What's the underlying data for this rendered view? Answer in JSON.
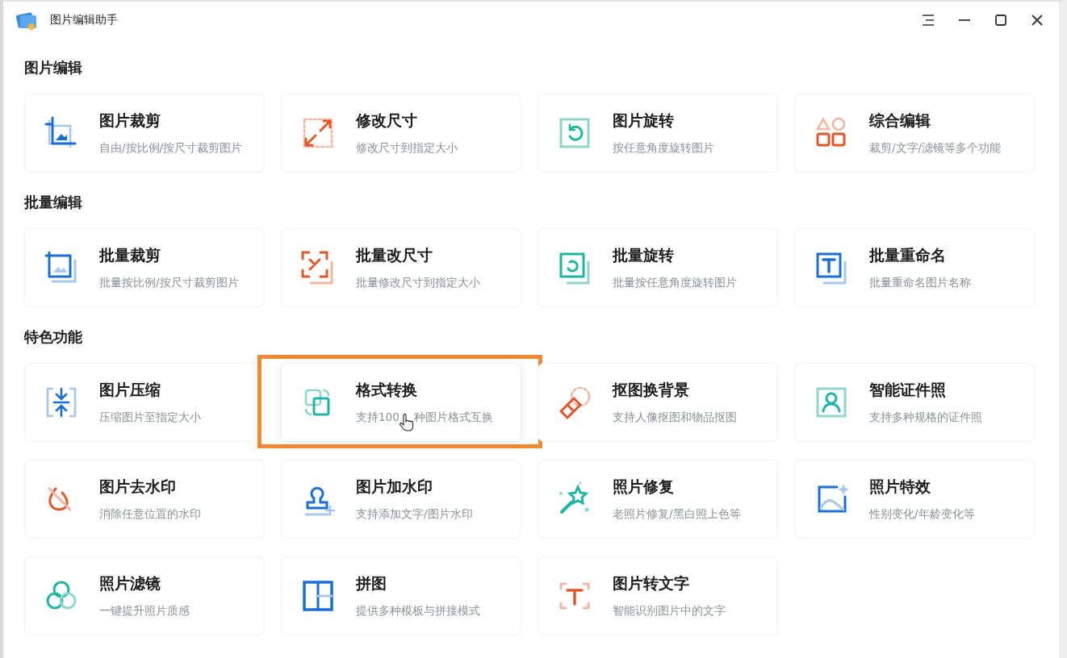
{
  "window": {
    "title": "图片编辑助手"
  },
  "sections": [
    {
      "title": "图片编辑",
      "cards": [
        {
          "title": "图片裁剪",
          "description": "自由/按比例/按尺寸裁剪图片",
          "hovered": false,
          "highlighted": false
        },
        {
          "title": "修改尺寸",
          "description": "修改尺寸到指定大小",
          "hovered": false,
          "highlighted": false
        },
        {
          "title": "图片旋转",
          "description": "按任意角度旋转图片",
          "hovered": false,
          "highlighted": false
        },
        {
          "title": "综合编辑",
          "description": "裁剪/文字/滤镜等多个功能",
          "hovered": false,
          "highlighted": false
        }
      ]
    },
    {
      "title": "批量编辑",
      "cards": [
        {
          "title": "批量裁剪",
          "description": "批量按比例/按尺寸裁剪图片",
          "hovered": false,
          "highlighted": false
        },
        {
          "title": "批量改尺寸",
          "description": "批量修改尺寸到指定大小",
          "hovered": false,
          "highlighted": false
        },
        {
          "title": "批量旋转",
          "description": "批量按任意角度旋转图片",
          "hovered": false,
          "highlighted": false
        },
        {
          "title": "批量重命名",
          "description": "批量重命名图片名称",
          "hovered": false,
          "highlighted": false
        }
      ]
    },
    {
      "title": "特色功能",
      "cards": [
        {
          "title": "图片压缩",
          "description": "压缩图片至指定大小",
          "hovered": false,
          "highlighted": false
        },
        {
          "title": "格式转换",
          "description": "支持100",
          "description_after_cursor": "种图片格式互换",
          "hovered": true,
          "highlighted": true
        },
        {
          "title": "抠图换背景",
          "description": "支持人像抠图和物品抠图",
          "hovered": false,
          "highlighted": false
        },
        {
          "title": "智能证件照",
          "description": "支持多种规格的证件照",
          "hovered": false,
          "highlighted": false
        },
        {
          "title": "图片去水印",
          "description": "消除任意位置的水印",
          "hovered": false,
          "highlighted": false
        },
        {
          "title": "图片加水印",
          "description": "支持添加文字/图片水印",
          "hovered": false,
          "highlighted": false
        },
        {
          "title": "照片修复",
          "description": "老照片修复/黑白照上色等",
          "hovered": false,
          "highlighted": false
        },
        {
          "title": "照片特效",
          "description": "性别变化/年龄变化等",
          "hovered": false,
          "highlighted": false
        },
        {
          "title": "照片滤镜",
          "description": "一键提升照片质感",
          "hovered": false,
          "highlighted": false
        },
        {
          "title": "拼图",
          "description": "提供多种模板与拼接模式",
          "hovered": false,
          "highlighted": false
        },
        {
          "title": "图片转文字",
          "description": "智能识别图片中的文字",
          "hovered": false,
          "highlighted": false
        }
      ]
    }
  ]
}
